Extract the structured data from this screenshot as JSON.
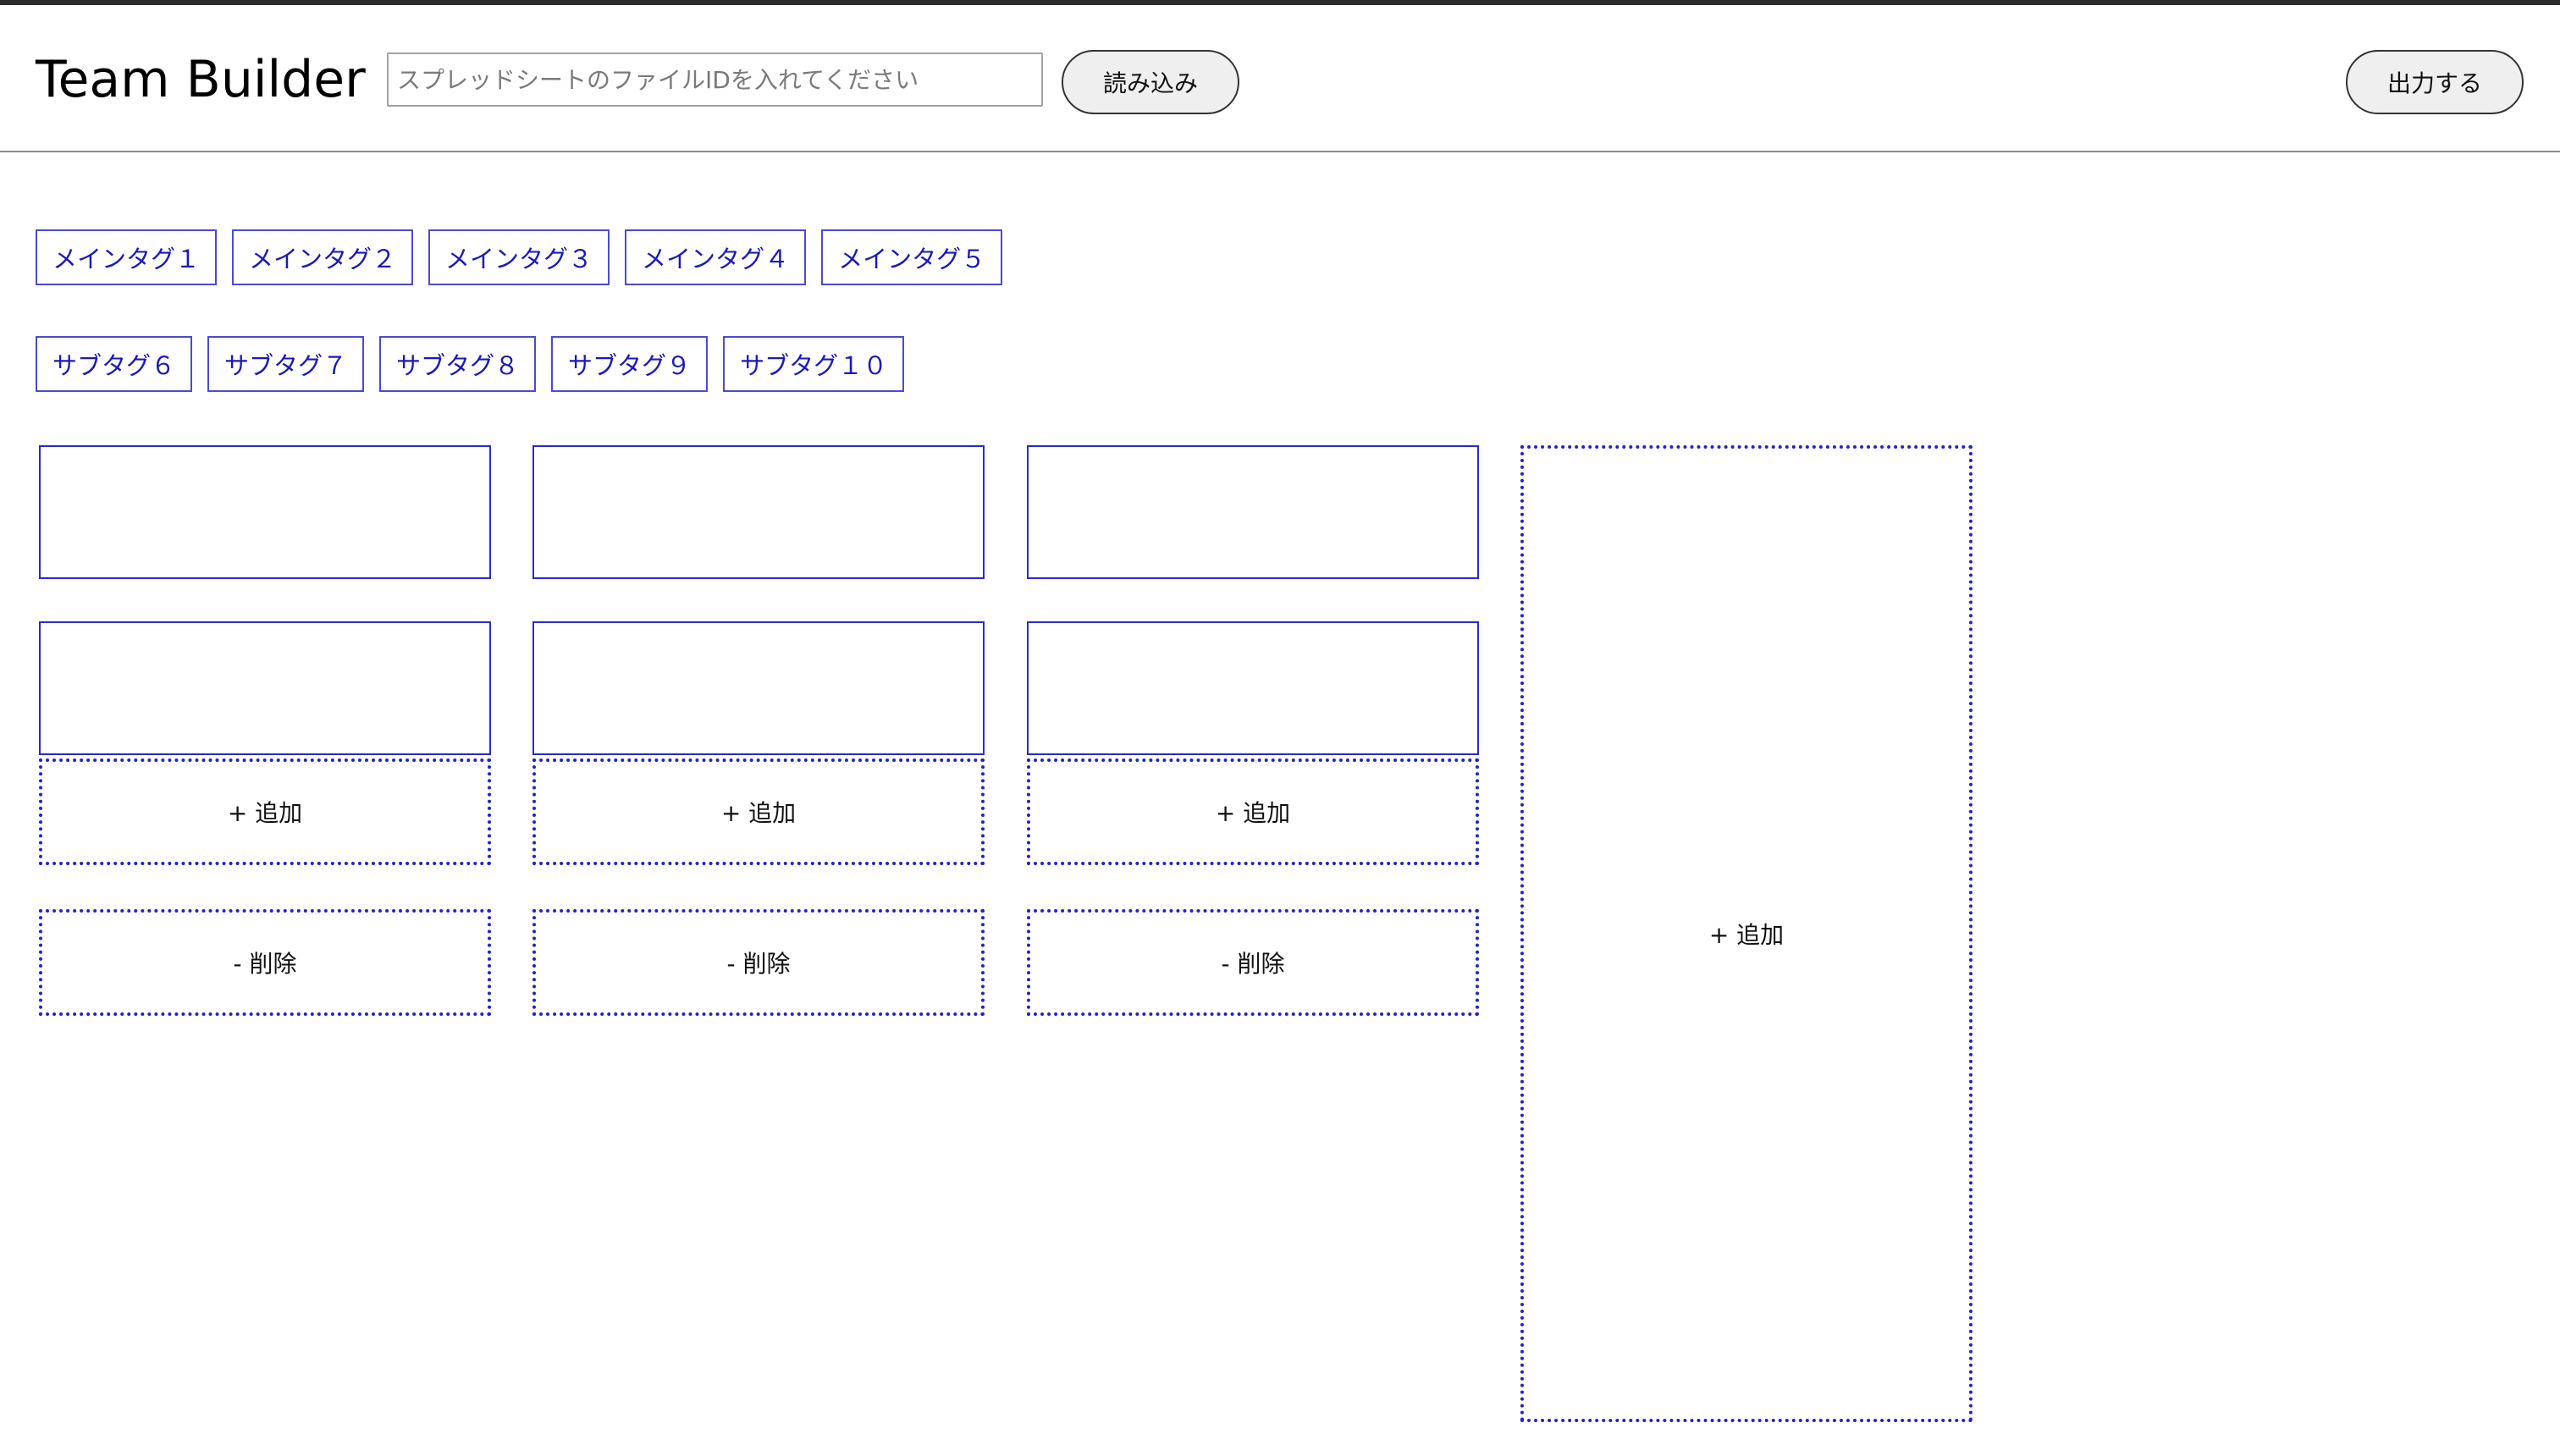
{
  "header": {
    "title": "Team Builder",
    "file_input": {
      "value": "",
      "placeholder": "スプレッドシートのファイルIDを入れてください"
    },
    "load_label": "読み込み",
    "export_label": "出力する"
  },
  "main_tags": [
    "メインタグ１",
    "メインタグ２",
    "メインタグ３",
    "メインタグ４",
    "メインタグ５"
  ],
  "sub_tags": [
    "サブタグ６",
    "サブタグ７",
    "サブタグ８",
    "サブタグ９",
    "サブタグ１０"
  ],
  "teams": [
    {
      "members": [
        "",
        ""
      ],
      "add_label": "+ 追加",
      "delete_label": "- 削除"
    },
    {
      "members": [
        "",
        ""
      ],
      "add_label": "+ 追加",
      "delete_label": "- 削除"
    },
    {
      "members": [
        "",
        ""
      ],
      "add_label": "+ 追加",
      "delete_label": "- 削除"
    }
  ],
  "add_team_label": "+ 追加",
  "colors": {
    "accent": "#2a2ad0",
    "tag_text": "#1a1ab8",
    "button_bg": "#efefef"
  }
}
